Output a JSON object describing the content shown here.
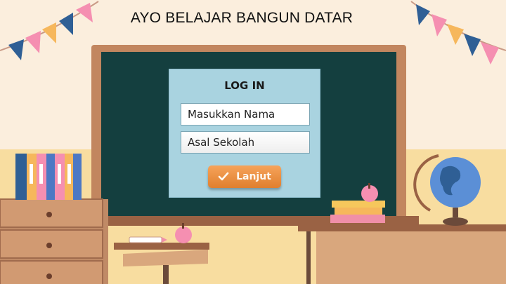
{
  "page": {
    "title": "AYO BELAJAR BANGUN DATAR"
  },
  "login": {
    "heading": "LOG IN",
    "name_placeholder": "Masukkan Nama",
    "school_placeholder": "Asal Sekolah",
    "submit_label": "Lanjut",
    "submit_icon": "check-icon"
  },
  "colors": {
    "board": "#143f3f",
    "panel": "#a9d3e0",
    "button": "#ef8f3e",
    "wall": "#fbeedd"
  }
}
